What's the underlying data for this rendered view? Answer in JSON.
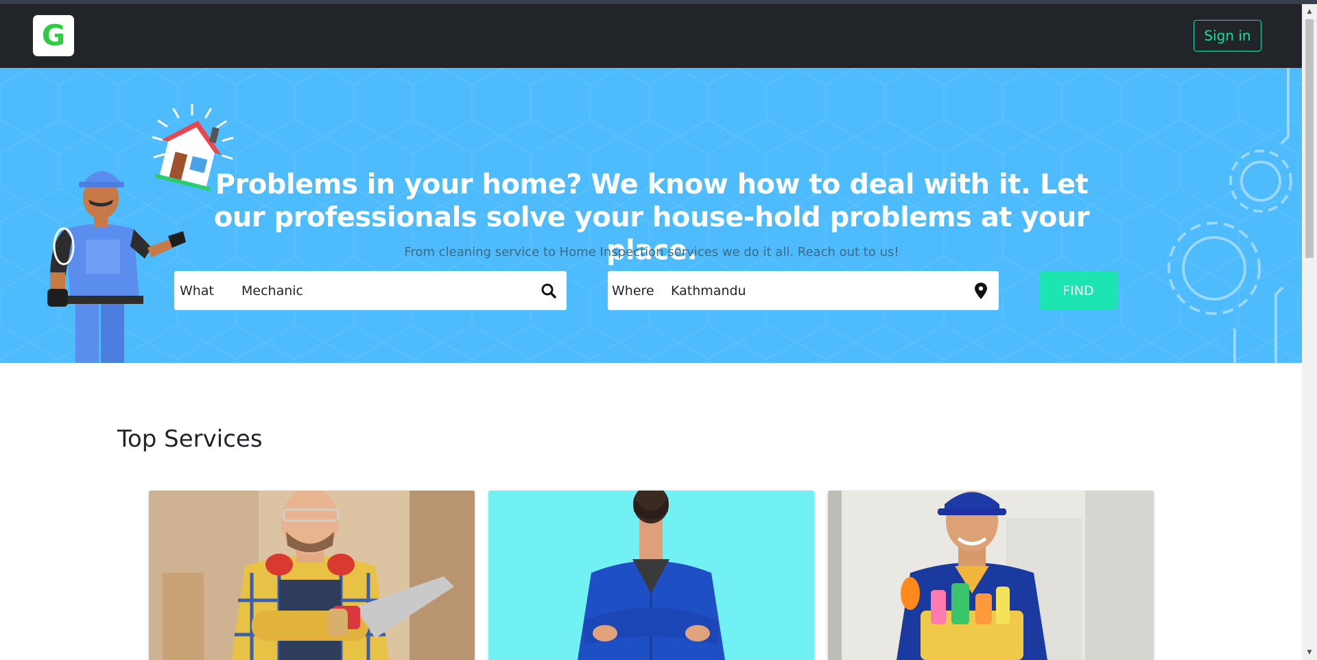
{
  "navbar": {
    "logo_letter": "G",
    "signin_label": "Sign in"
  },
  "hero": {
    "title": "Problems in your home? We know how to deal with it. Let our professionals solve your house-hold problems at your place.",
    "subtitle": "From cleaning service to Home Inspection services we do it all. Reach out to us!",
    "what_label": "What",
    "what_value": "Mechanic",
    "where_label": "Where",
    "where_value": "Kathmandu",
    "find_label": "FIND"
  },
  "services": {
    "title": "Top Services"
  },
  "colors": {
    "nav_bg": "#212529",
    "accent": "#1de5b2",
    "hero_bg": "#4dbbfc",
    "logo_green": "#2ecc40"
  },
  "icons": {
    "search": "search-icon",
    "location": "map-pin-icon"
  }
}
